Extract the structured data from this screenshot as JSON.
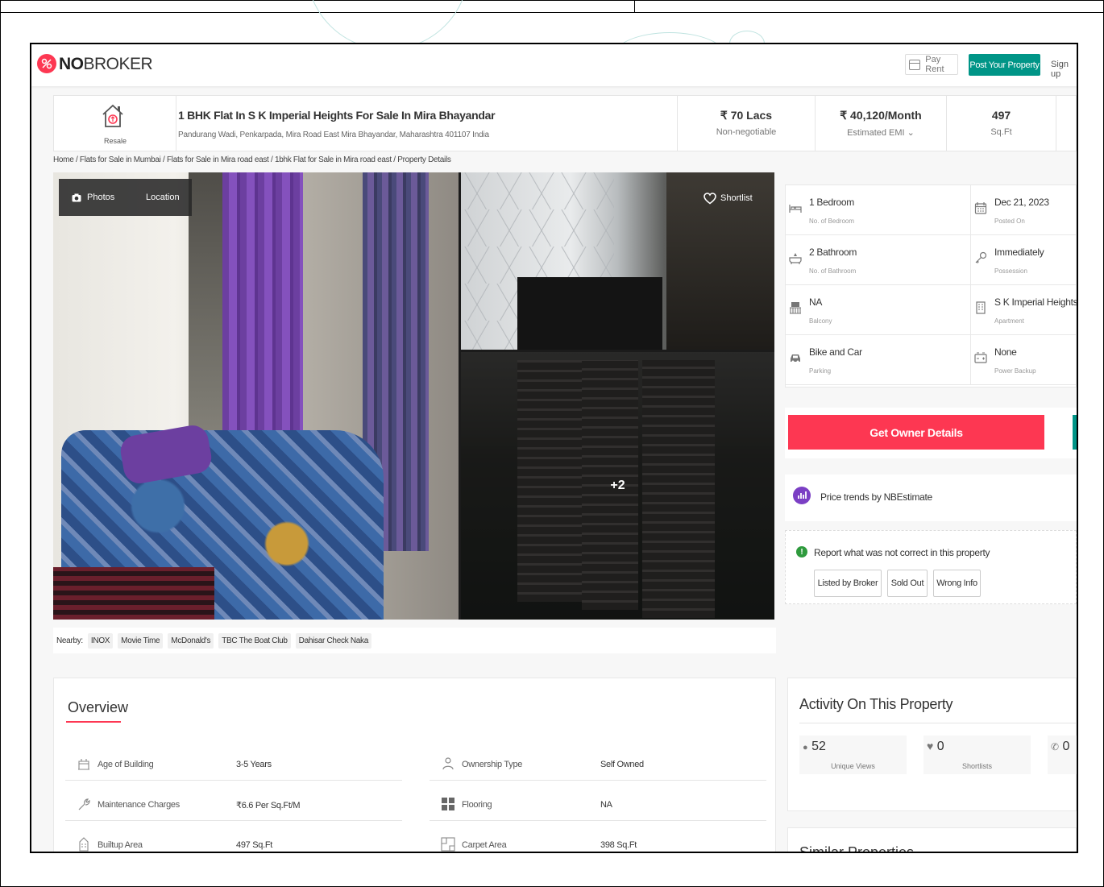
{
  "header": {
    "logo_bold": "NO",
    "logo_rest": "BROKER",
    "pay_rent": "Pay Rent",
    "post_property": "Post Your Property",
    "sign_up": "Sign up"
  },
  "listing": {
    "badge": "Resale",
    "title": "1 BHK Flat In S K Imperial Heights For Sale In Mira Bhayandar",
    "address": "Pandurang Wadi, Penkarpada, Mira Road East Mira Bhayandar, Maharashtra 401107 India",
    "price": "₹ 70 Lacs",
    "price_note": "Non-negotiable",
    "emi": "₹ 40,120/Month",
    "emi_note": "Estimated EMI ⌄",
    "area": "497",
    "area_unit": "Sq.Ft"
  },
  "breadcrumb": "Home / Flats for Sale in Mumbai / Flats for Sale in Mira road east / 1bhk Flat for Sale in Mira road east / Property Details",
  "gallery": {
    "photos_btn": "Photos",
    "location_btn": "Location",
    "shortlist_btn": "Shortlist",
    "more_count": "+2"
  },
  "nearby": {
    "label": "Nearby:",
    "places": [
      "INOX",
      "Movie Time",
      "McDonald's",
      "TBC The Boat Club",
      "Dahisar Check Naka"
    ]
  },
  "specs": [
    {
      "value": "1 Bedroom",
      "label": "No. of Bedroom",
      "icon": "bed-icon"
    },
    {
      "value": "Dec 21, 2023",
      "label": "Posted On",
      "icon": "calendar-icon"
    },
    {
      "value": "2 Bathroom",
      "label": "No. of Bathroom",
      "icon": "bathtub-icon"
    },
    {
      "value": "Immediately",
      "label": "Possession",
      "icon": "key-icon"
    },
    {
      "value": "NA",
      "label": "Balcony",
      "icon": "balcony-icon"
    },
    {
      "value": "S K Imperial Heights",
      "label": "Apartment",
      "icon": "building-icon"
    },
    {
      "value": "Bike and Car",
      "label": "Parking",
      "icon": "car-icon"
    },
    {
      "value": "None",
      "label": "Power Backup",
      "icon": "battery-icon"
    }
  ],
  "cta": {
    "get_owner": "Get Owner Details",
    "price_trends": "Price trends by NBEstimate"
  },
  "report": {
    "text": "Report what was not correct in this property",
    "buttons": [
      "Listed by Broker",
      "Sold Out",
      "Wrong Info"
    ]
  },
  "overview": {
    "title": "Overview",
    "rows": [
      {
        "label": "Age of Building",
        "value": "3-5 Years"
      },
      {
        "label": "Ownership Type",
        "value": "Self Owned"
      },
      {
        "label": "Maintenance Charges",
        "value": "₹6.6 Per Sq.Ft/M"
      },
      {
        "label": "Flooring",
        "value": "NA"
      },
      {
        "label": "Builtup Area",
        "value": "497 Sq.Ft"
      },
      {
        "label": "Carpet Area",
        "value": "398 Sq.Ft"
      }
    ]
  },
  "activity": {
    "title": "Activity On This Property",
    "stats": [
      {
        "value": "52",
        "label": "Unique Views"
      },
      {
        "value": "0",
        "label": "Shortlists"
      },
      {
        "value": "0",
        "label": ""
      }
    ]
  },
  "similar": {
    "title": "Similar Properties"
  },
  "colors": {
    "brand_red": "#fd3752",
    "brand_teal": "#009587",
    "trend_purple": "#7b3fc4",
    "report_green": "#2e9a3d"
  }
}
